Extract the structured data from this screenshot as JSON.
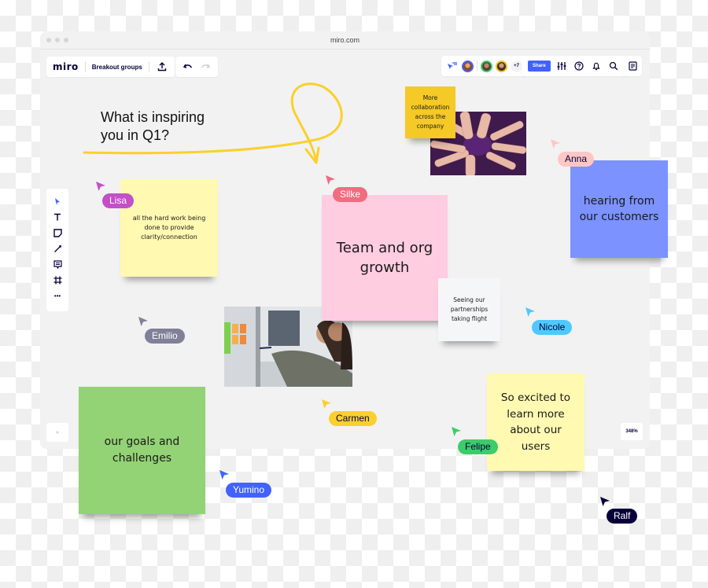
{
  "window": {
    "url": "miro.com"
  },
  "header": {
    "logo": "miro",
    "board_name": "Breakout groups",
    "share_label": "Share",
    "collaborators_more": "+7",
    "icons": [
      "upload-icon",
      "undo-icon",
      "redo-icon",
      "follow-cursor-icon",
      "settings-sliders-icon",
      "help-icon",
      "bell-icon",
      "search-icon",
      "notes-icon"
    ]
  },
  "toolbar": {
    "tools": [
      "select",
      "text",
      "sticky-note",
      "line",
      "comment",
      "frame",
      "more"
    ],
    "more_label": "•••"
  },
  "footer": {
    "collapse_label": "»",
    "zoom_level": "348%"
  },
  "board": {
    "question": "What is inspiring you in Q1?",
    "stickies": [
      {
        "id": "hard-work",
        "text": "all the hard work being done to provide clarity/connection",
        "color": "#fff9b1"
      },
      {
        "id": "collaboration",
        "text": "More collaboration across the company",
        "color": "#f5c926"
      },
      {
        "id": "customers",
        "text": "hearing from our customers",
        "color": "#7b92ff"
      },
      {
        "id": "team-growth",
        "text": "Team and org growth",
        "color": "#ffcce0"
      },
      {
        "id": "partnerships",
        "text": "Seeing our partnerships taking flight",
        "color": "#f5f6f8"
      },
      {
        "id": "excited",
        "text": "So excited to learn more about our users",
        "color": "#fff9b1"
      },
      {
        "id": "goals",
        "text": "our goals and challenges",
        "color": "#93d275"
      }
    ],
    "photos": [
      "hands-together-photo",
      "office-whiteboard-photo"
    ],
    "cursors": [
      {
        "name": "Lisa",
        "color": "#c44fc8",
        "text_color": "#ffffff"
      },
      {
        "name": "Silke",
        "color": "#f16c7f",
        "text_color": "#ffffff"
      },
      {
        "name": "Anna",
        "color": "#ffc6c6",
        "text_color": "#050038"
      },
      {
        "name": "Emilio",
        "color": "#808099",
        "text_color": "#ffffff"
      },
      {
        "name": "Nicole",
        "color": "#4fc8ff",
        "text_color": "#050038"
      },
      {
        "name": "Carmen",
        "color": "#fad02c",
        "text_color": "#050038"
      },
      {
        "name": "Felipe",
        "color": "#3ccc6a",
        "text_color": "#050038"
      },
      {
        "name": "Yumino",
        "color": "#4262ff",
        "text_color": "#ffffff"
      },
      {
        "name": "Ralf",
        "color": "#050038",
        "text_color": "#ffffff"
      }
    ]
  }
}
